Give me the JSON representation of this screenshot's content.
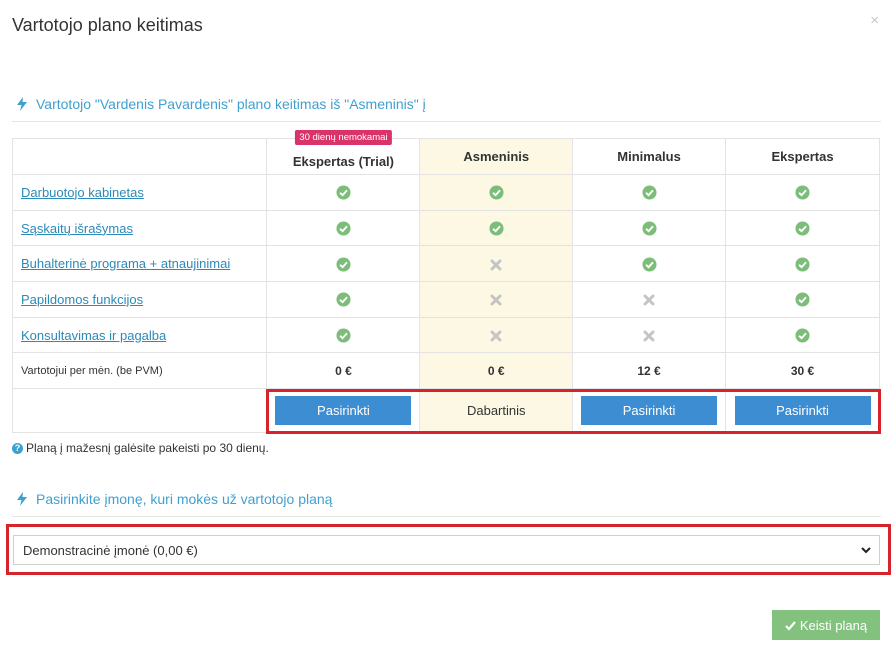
{
  "modal": {
    "title": "Vartotojo plano keitimas",
    "close": "×"
  },
  "section_change": {
    "heading": "Vartotojo \"Vardenis Pavardenis\" plano keitimas iš \"Asmeninis\" į"
  },
  "plans": {
    "badge": "30 dienų nemokamai",
    "columns": [
      "Ekspertas (Trial)",
      "Asmeninis",
      "Minimalus",
      "Ekspertas"
    ],
    "current_column": 1,
    "features": [
      {
        "label": "Darbuotojo kabinetas",
        "values": [
          true,
          true,
          true,
          true
        ]
      },
      {
        "label": "Sąskaitų išrašymas",
        "values": [
          true,
          true,
          true,
          true
        ]
      },
      {
        "label": "Buhalterinė programa + atnaujinimai",
        "values": [
          true,
          false,
          true,
          true
        ]
      },
      {
        "label": "Papildomos funkcijos",
        "values": [
          true,
          false,
          false,
          true
        ]
      },
      {
        "label": "Konsultavimas ir pagalba",
        "values": [
          true,
          false,
          false,
          true
        ]
      }
    ],
    "price_label": "Vartotojui per mėn. (be PVM)",
    "prices": [
      "0 €",
      "0 €",
      "12 €",
      "30 €"
    ],
    "select_label": "Pasirinkti",
    "current_label": "Dabartinis"
  },
  "note": "Planą į mažesnį galėsite pakeisti po 30 dienų.",
  "section_company": {
    "heading": "Pasirinkite įmonę, kuri mokės už vartotojo planą",
    "selected": "Demonstracinė įmonė (0,00 €)"
  },
  "submit_label": "Keisti planą",
  "colors": {
    "accent": "#3fa0cf",
    "button": "#3d8dd3",
    "ok": "#7dbd7a",
    "no": "#c4c4c4",
    "badge": "#d9336a",
    "current_bg": "#fcf8e3",
    "submit": "#82c17e",
    "highlight": "#d6242c"
  },
  "icons": {
    "section": "bolt-icon",
    "ok": "check-circle-icon",
    "no": "cross-icon",
    "note": "question-circle-icon",
    "select": "chevron-down-icon",
    "submit": "check-icon"
  }
}
